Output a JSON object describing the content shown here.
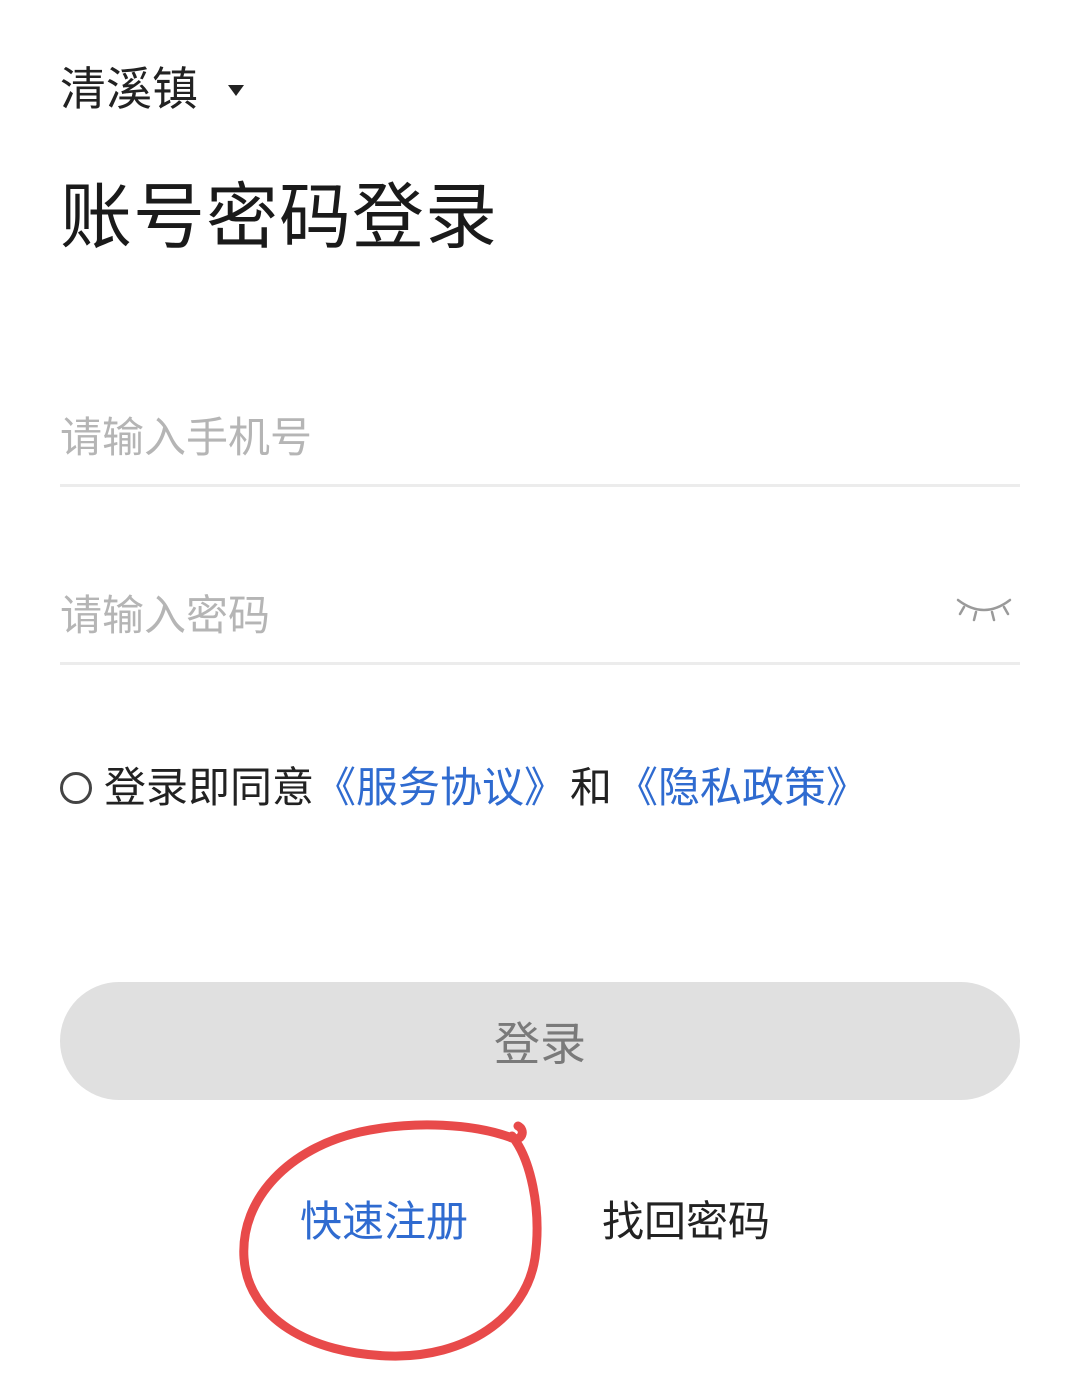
{
  "location": {
    "name": "清溪镇"
  },
  "page_title": "账号密码登录",
  "phone_field": {
    "placeholder": "请输入手机号",
    "value": ""
  },
  "password_field": {
    "placeholder": "请输入密码",
    "value": ""
  },
  "agreement": {
    "checked": false,
    "prefix": "登录即同意",
    "service_link": "《服务协议》",
    "and": "和",
    "privacy_link": "《隐私政策》"
  },
  "login_button": {
    "label": "登录"
  },
  "links": {
    "register": "快速注册",
    "recover_password": "找回密码"
  },
  "colors": {
    "link_blue": "#2f6bd0",
    "annotation_red": "#e84a4a",
    "button_bg": "#e0e0e0"
  },
  "icons": {
    "location_dropdown": "caret-down-icon",
    "password_visibility": "eye-closed-icon",
    "agreement_check": "radio-unchecked-icon"
  }
}
